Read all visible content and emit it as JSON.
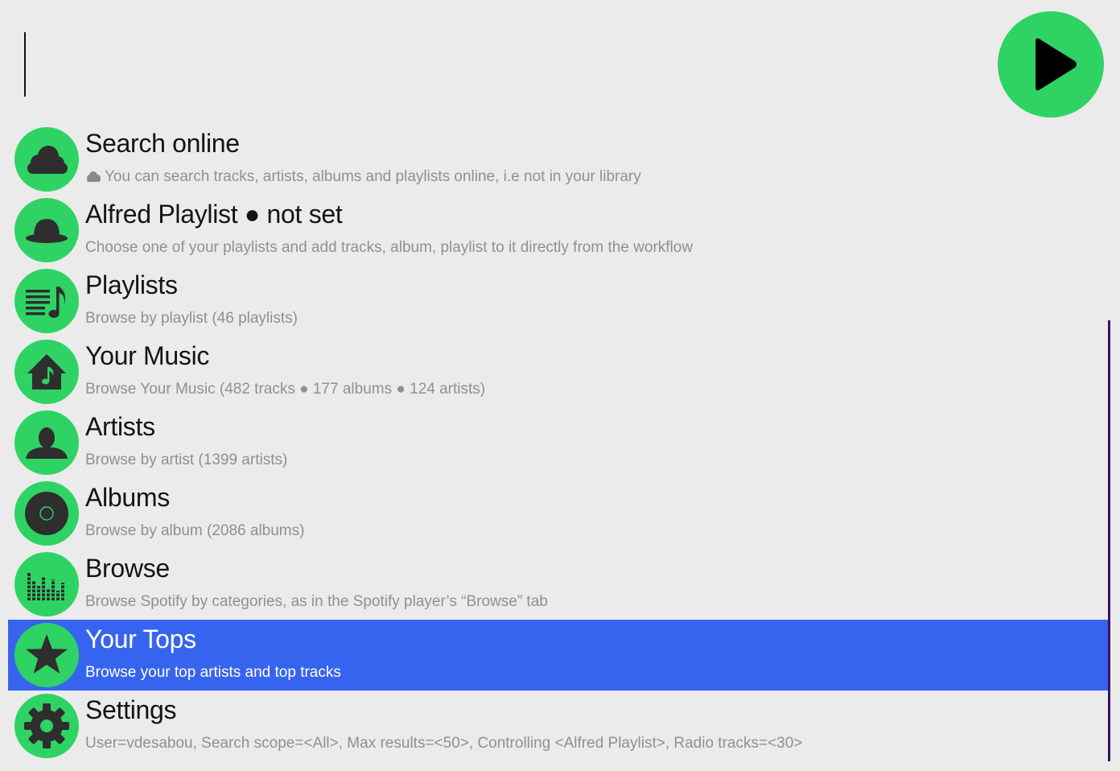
{
  "search": {
    "value": "",
    "placeholder": ""
  },
  "app_icon": "play-icon",
  "colors": {
    "background": "#ebebeb",
    "accent_green": "#2ed364",
    "selection_blue": "#3764ef",
    "icon_dark": "#2e2e2e",
    "subtitle_gray": "#909090",
    "scrollbar": "#3b1465"
  },
  "results": [
    {
      "title": "Search online",
      "subtitle": "You can search tracks, artists, albums and playlists online, i.e not in your library",
      "icon": "cloud-icon"
    },
    {
      "title": "Alfred Playlist ● not set",
      "subtitle": "Choose one of your playlists and add tracks, album, playlist to it directly from the workflow",
      "icon": "bowler-hat-icon"
    },
    {
      "title": "Playlists",
      "subtitle": "Browse by playlist (46 playlists)",
      "icon": "playlist-icon"
    },
    {
      "title": "Your Music",
      "subtitle": "Browse Your Music (482 tracks ● 177  albums ● 124 artists)",
      "icon": "music-house-icon"
    },
    {
      "title": "Artists",
      "subtitle": "Browse by artist (1399 artists)",
      "icon": "person-icon"
    },
    {
      "title": "Albums",
      "subtitle": "Browse by album (2086 albums)",
      "icon": "vinyl-icon"
    },
    {
      "title": "Browse",
      "subtitle": "Browse Spotify by categories, as in the Spotify player’s “Browse” tab",
      "icon": "equalizer-icon"
    },
    {
      "title": "Your Tops",
      "subtitle": "Browse your top artists and top tracks",
      "icon": "star-icon",
      "selected": true
    },
    {
      "title": "Settings",
      "subtitle": "User=vdesabou, Search scope=<All>, Max results=<50>, Controlling <Alfred Playlist>, Radio tracks=<30>",
      "icon": "gear-icon"
    }
  ]
}
